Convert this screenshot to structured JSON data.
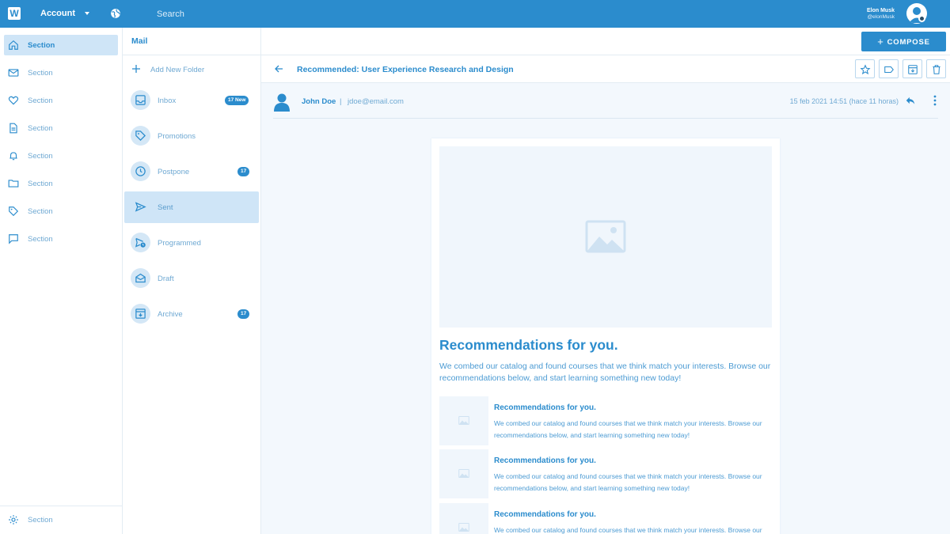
{
  "topbar": {
    "logo_letter": "W",
    "account_label": "Account",
    "search_placeholder": "Search",
    "user_name": "Elon Musk",
    "user_handle": "@elonMusk"
  },
  "sidebar": {
    "items": [
      {
        "label": "Section",
        "icon": "home-icon",
        "active": true
      },
      {
        "label": "Section",
        "icon": "mail-icon"
      },
      {
        "label": "Section",
        "icon": "heart-icon"
      },
      {
        "label": "Section",
        "icon": "document-icon"
      },
      {
        "label": "Section",
        "icon": "bell-icon"
      },
      {
        "label": "Section",
        "icon": "folder-icon"
      },
      {
        "label": "Section",
        "icon": "tag-icon"
      },
      {
        "label": "Section",
        "icon": "chat-icon"
      }
    ],
    "settings": {
      "label": "Section",
      "icon": "gear-icon"
    }
  },
  "mail": {
    "title": "Mail",
    "add_folder_label": "Add New Folder",
    "folders": [
      {
        "label": "Inbox",
        "icon": "inbox-icon",
        "badge": "17 New"
      },
      {
        "label": "Promotions",
        "icon": "tag-icon",
        "badge": ""
      },
      {
        "label": "Postpone",
        "icon": "clock-icon",
        "badge": "17"
      },
      {
        "label": "Sent",
        "icon": "send-icon",
        "badge": "",
        "active": true
      },
      {
        "label": "Programmed",
        "icon": "scheduled-send-icon",
        "badge": ""
      },
      {
        "label": "Draft",
        "icon": "draft-icon",
        "badge": ""
      },
      {
        "label": "Archive",
        "icon": "archive-icon",
        "badge": "17"
      }
    ]
  },
  "main": {
    "compose_label": "COMPOSE",
    "subject": "Recommended: User Experience Research and Design",
    "toolbar": [
      "star-icon",
      "label-icon",
      "archive-icon",
      "trash-icon"
    ],
    "sender": {
      "name": "John Doe",
      "separator": "|",
      "email": "jdoe@email.com",
      "date": "15 feb 2021 14:51 (hace 11 horas)"
    },
    "email": {
      "title": "Recommendations for you.",
      "text": "We combed our catalog and found courses that we think match your interests. Browse our recommendations below, and start learning something new today!",
      "recs": [
        {
          "title": "Recommendations for you.",
          "text": "We combed our catalog and found courses that we think match your interests. Browse our recommendations below, and start learning something new today!"
        },
        {
          "title": "Recommendations for you.",
          "text": "We combed our catalog and found courses that we think match your interests. Browse our recommendations below, and start learning something new today!"
        },
        {
          "title": "Recommendations for you.",
          "text": "We combed our catalog and found courses that we think match your interests. Browse our recommendations below, and start learning something new today!"
        }
      ]
    }
  },
  "colors": {
    "primary": "#2b8ccd",
    "active_bg": "#cfe5f7",
    "muted_text": "#6fa9d3",
    "content_bg": "#f3f8fd"
  }
}
